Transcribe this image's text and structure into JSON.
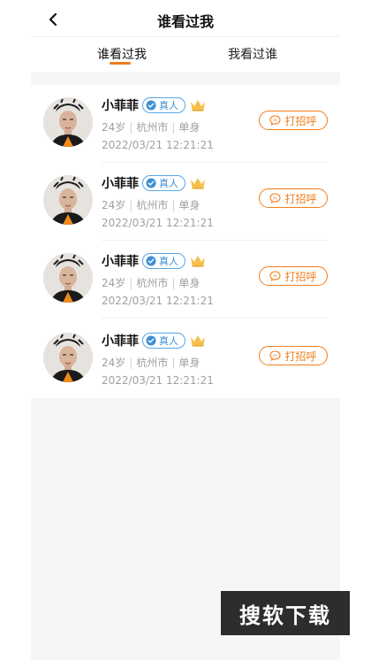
{
  "nav": {
    "title": "谁看过我",
    "back_icon": "chevron-left-icon"
  },
  "tabs": [
    {
      "label": "谁看过我",
      "active": true
    },
    {
      "label": "我看过谁",
      "active": false
    }
  ],
  "colors": {
    "accent": "#f07d1b",
    "verify": "#3d8fd6",
    "crown": "#f5c04a",
    "meta_text": "#a0a0a0",
    "background": "#f6f6f6"
  },
  "visitors": [
    {
      "name": "小菲菲",
      "badge": "真人",
      "age": "24岁",
      "city": "杭州市",
      "status": "单身",
      "time": "2022/03/21 12:21:21",
      "action": "打招呼"
    },
    {
      "name": "小菲菲",
      "badge": "真人",
      "age": "24岁",
      "city": "杭州市",
      "status": "单身",
      "time": "2022/03/21 12:21:21",
      "action": "打招呼"
    },
    {
      "name": "小菲菲",
      "badge": "真人",
      "age": "24岁",
      "city": "杭州市",
      "status": "单身",
      "time": "2022/03/21 12:21:21",
      "action": "打招呼"
    },
    {
      "name": "小菲菲",
      "badge": "真人",
      "age": "24岁",
      "city": "杭州市",
      "status": "单身",
      "time": "2022/03/21 12:21:21",
      "action": "打招呼"
    }
  ],
  "watermark": "搜软下载"
}
